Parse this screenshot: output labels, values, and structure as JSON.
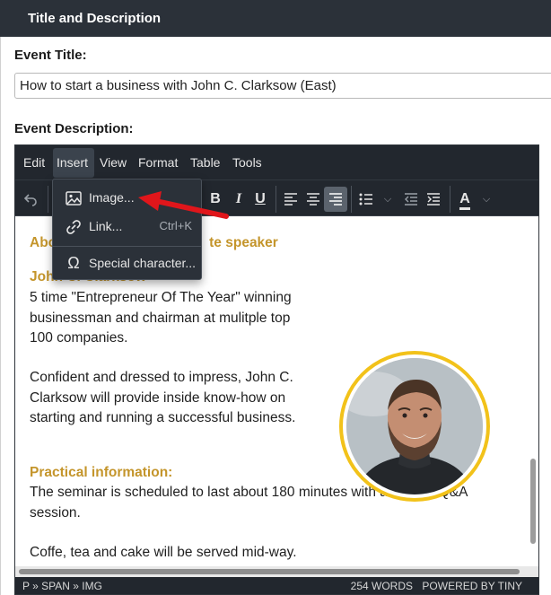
{
  "panel": {
    "title": "Title and Description"
  },
  "event_title": {
    "label": "Event Title:",
    "value": "How to start a business with John C. Clarksow (East)"
  },
  "event_description": {
    "label": "Event Description:"
  },
  "menubar": {
    "items": [
      "Edit",
      "Insert",
      "View",
      "Format",
      "Table",
      "Tools"
    ],
    "active": "Insert"
  },
  "toolbar": {
    "icons": [
      "undo-icon",
      "bold-icon",
      "italic-icon",
      "underline-icon",
      "align-left-icon",
      "align-center-icon",
      "align-right-icon",
      "bullet-list-icon",
      "chevron-down-icon",
      "outdent-icon",
      "indent-icon",
      "text-color-icon",
      "chevron-down-icon"
    ]
  },
  "dropdown": {
    "items": [
      {
        "label": "Image...",
        "shortcut": "",
        "icon": "image-icon"
      },
      {
        "label": "Link...",
        "shortcut": "Ctrl+K",
        "icon": "link-icon"
      },
      {
        "label": "Special character...",
        "shortcut": "",
        "icon": "omega-icon"
      }
    ]
  },
  "content": {
    "about_heading_visible": "Abo",
    "about_heading_tail": "te speaker",
    "name_heading": "John C. Clarksow",
    "para1": [
      "5 time \"Entrepreneur Of The Year\" winning",
      "businessman and chairman at mulitple top",
      "100 companies."
    ],
    "para2": [
      "Confident and dressed to impress, John C.",
      "Clarksow will provide inside know-how on",
      "starting and running a successful business."
    ],
    "practical_heading": "Practical information:",
    "para3": [
      "The seminar is scheduled to last about 180 minutes with a closing Q&A",
      "session."
    ],
    "para4": "Coffe, tea and cake will be served mid-way."
  },
  "statusbar": {
    "path": "P » SPAN » IMG",
    "words": "254 WORDS",
    "powered": "POWERED BY TINY"
  },
  "colors": {
    "accent_heading": "#c4952b",
    "photo_ring": "#f2c21a",
    "arrow": "#e0161b",
    "editor_chrome": "#22272e"
  }
}
